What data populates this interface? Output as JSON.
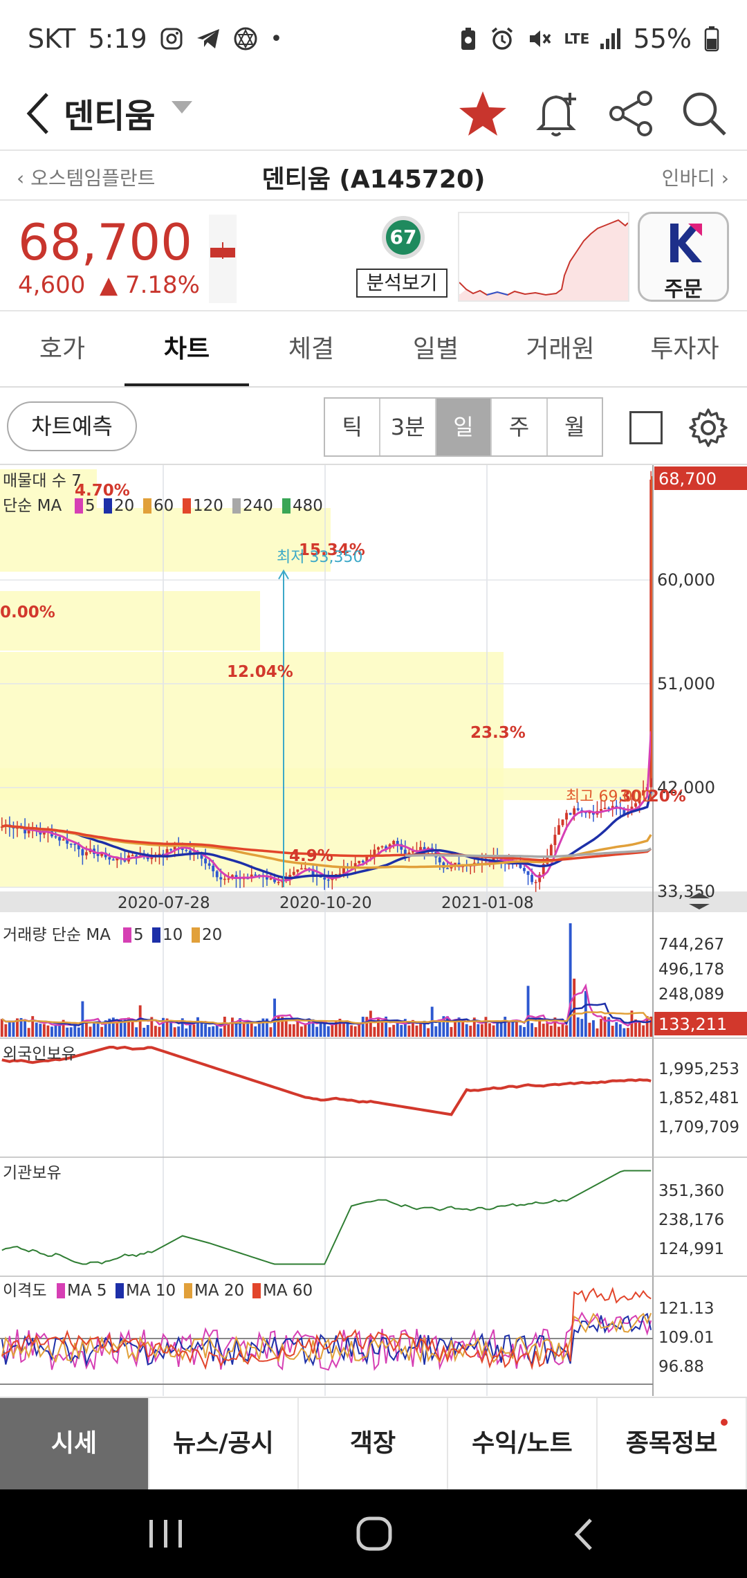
{
  "status_bar": {
    "carrier": "SKT",
    "time": "5:19",
    "battery": "55%",
    "network": "LTE"
  },
  "header": {
    "title": "덴티움"
  },
  "subheader": {
    "prev_stock": "오스템임플란트",
    "current": "덴티움 (A145720)",
    "next_stock": "인바디"
  },
  "quote": {
    "price": "68,700",
    "change": "4,600",
    "change_pct": "7.18%",
    "score": "67",
    "analysis_label": "분석보기",
    "order_label": "주문",
    "colors": {
      "up": "#c8352d"
    }
  },
  "tabs": [
    "호가",
    "차트",
    "체결",
    "일별",
    "거래원",
    "투자자"
  ],
  "active_tab": 1,
  "controls": {
    "predict_label": "차트예측",
    "periods": [
      "틱",
      "3분",
      "일",
      "주",
      "월"
    ],
    "active_period": 2
  },
  "chart_data": {
    "type": "line",
    "price_panel": {
      "legend_title": "매물대 수 7",
      "ma_title": "단순 MA",
      "ma_periods": [
        "5",
        "20",
        "60",
        "120",
        "240",
        "480"
      ],
      "ma_colors": [
        "#d63fb4",
        "#1d2fa8",
        "#e1a03a",
        "#e2452b",
        "#a8a8a8",
        "#3aa656"
      ],
      "y_ticks": [
        "60,000",
        "51,000",
        "42,000",
        "33,350"
      ],
      "current_price_label": "68,700",
      "ylim": [
        33350,
        69000
      ],
      "volume_profile_pcts": [
        "4.70%",
        "15.34%",
        "0.00%",
        "12.04%",
        "23.3%",
        "4.9%",
        "30.20%"
      ],
      "annotations": {
        "low": "최저 33,350",
        "high": "최고 69,000"
      },
      "x_ticks": [
        "2020-07-28",
        "2020-10-20",
        "2021-01-08"
      ]
    },
    "volume_panel": {
      "title": "거래량 단순 MA",
      "ma_periods": [
        "5",
        "10",
        "20"
      ],
      "ma_colors": [
        "#d63fb4",
        "#1d2fa8",
        "#e1a03a"
      ],
      "y_ticks": [
        "744,267",
        "496,178",
        "248,089"
      ],
      "current_label": "133,211"
    },
    "foreign_panel": {
      "title": "외국인보유",
      "y_ticks": [
        "1,995,253",
        "1,852,481",
        "1,709,709"
      ]
    },
    "inst_panel": {
      "title": "기관보유",
      "y_ticks": [
        "351,360",
        "238,176",
        "124,991"
      ]
    },
    "disparity_panel": {
      "title": "이격도",
      "series": [
        "MA 5",
        "MA 10",
        "MA 20",
        "MA 60"
      ],
      "colors": [
        "#d63fb4",
        "#1d2fa8",
        "#e1a03a",
        "#e2452b"
      ],
      "y_ticks": [
        "121.13",
        "109.01",
        "96.88"
      ]
    }
  },
  "bottom_nav": [
    "시세",
    "뉴스/공시",
    "객장",
    "수익/노트",
    "종목정보"
  ],
  "active_bottom": 0
}
